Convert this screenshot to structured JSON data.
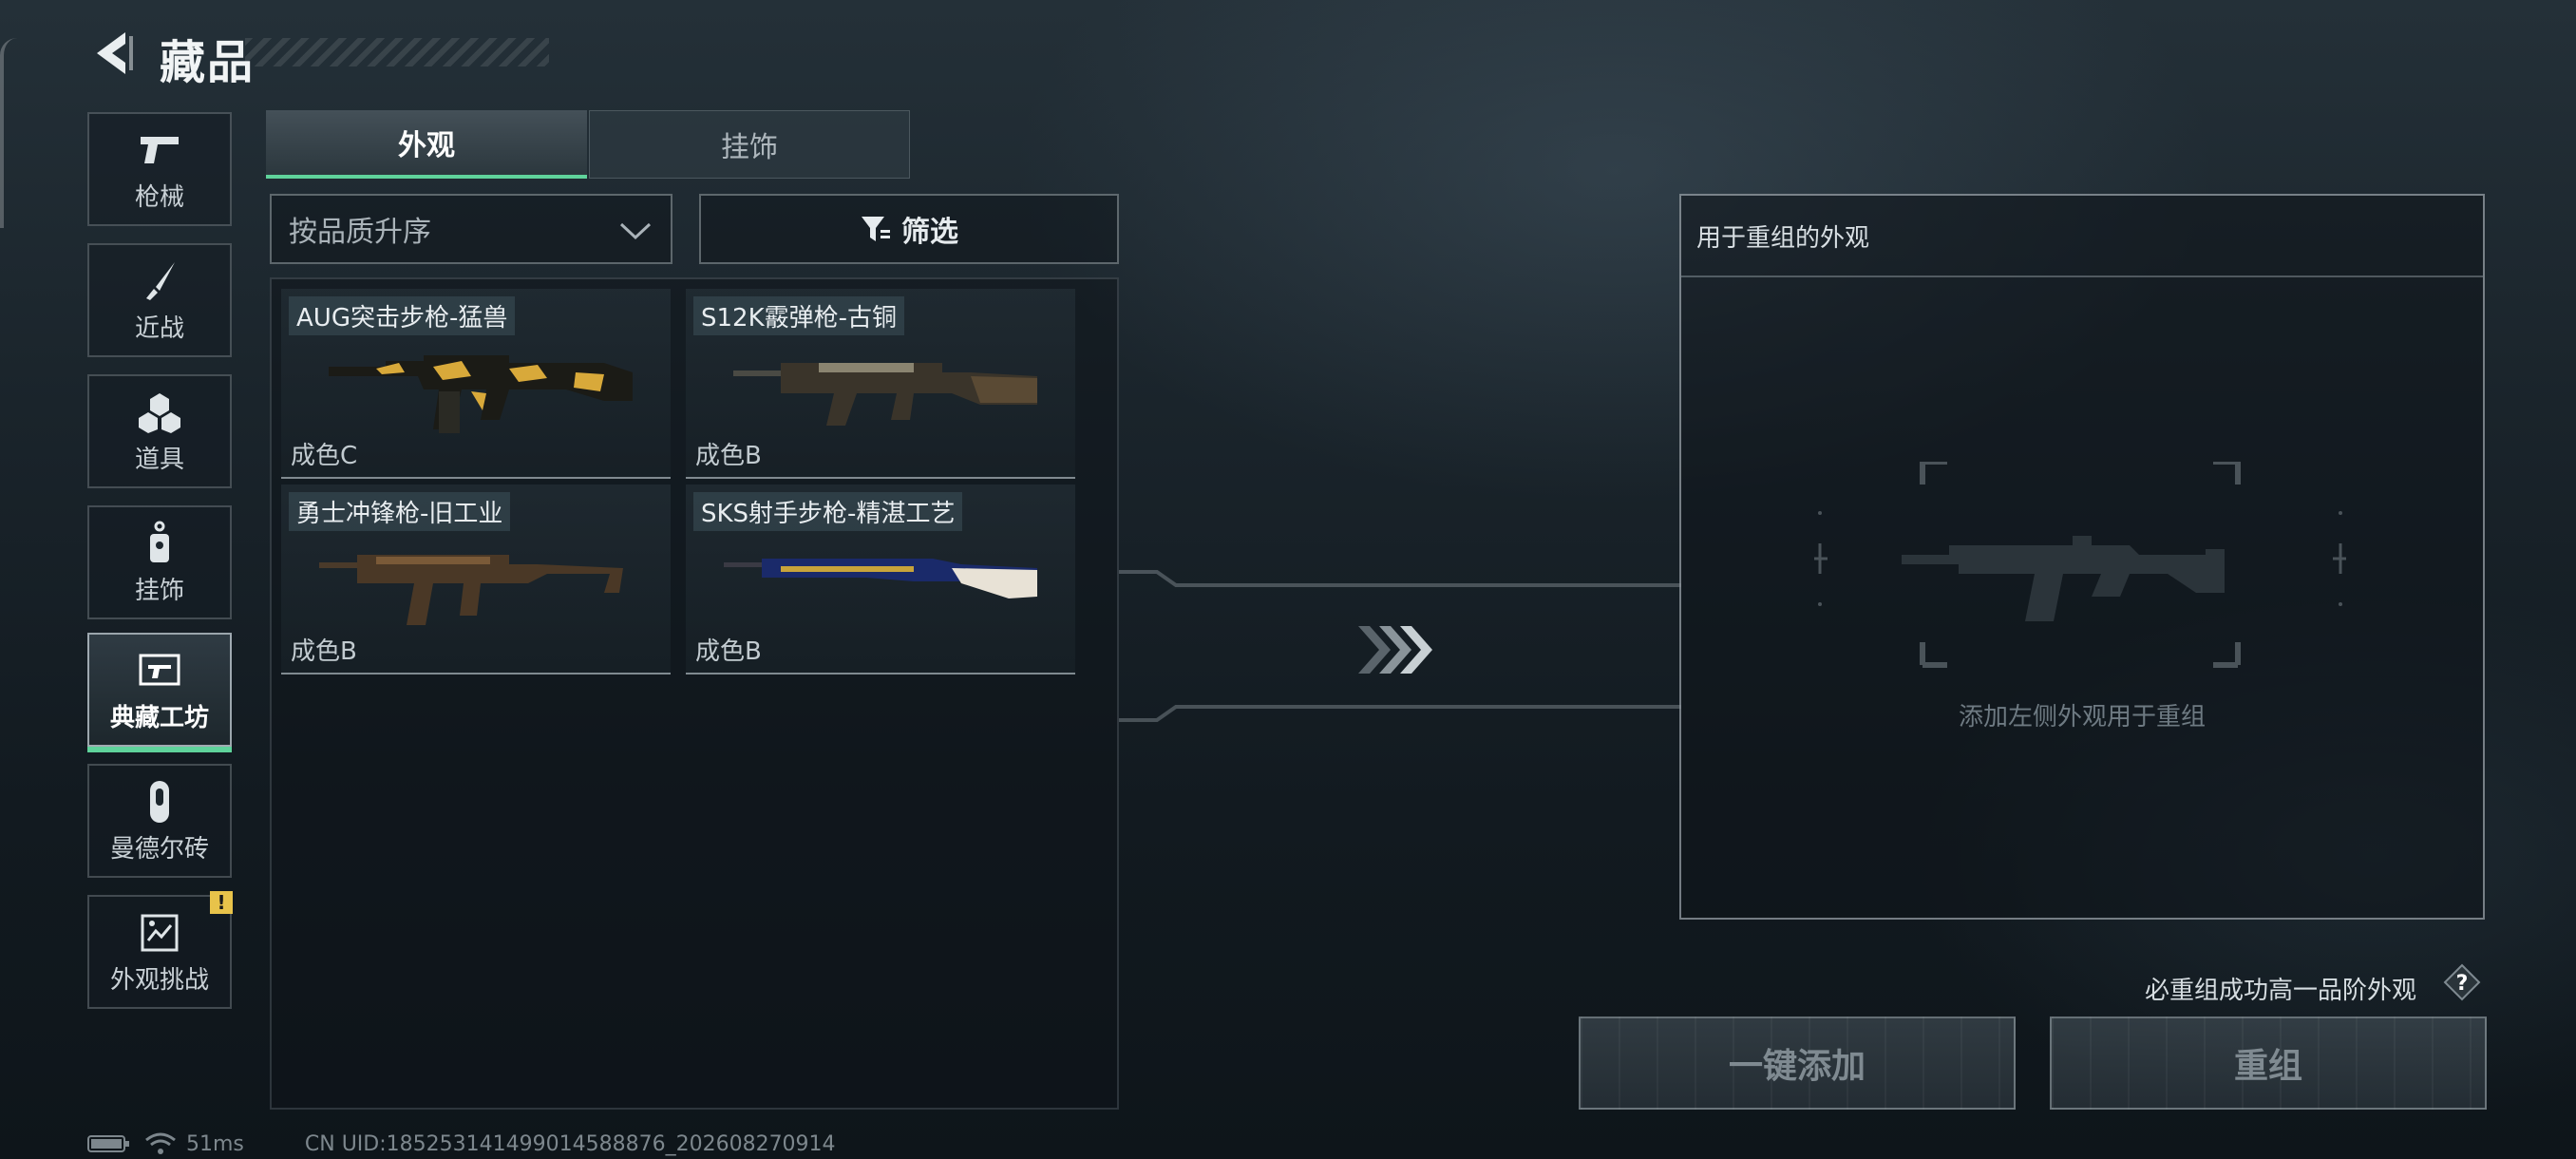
{
  "header": {
    "title": "藏品"
  },
  "sidebar": {
    "items": [
      {
        "label": "枪械",
        "icon": "pistol-icon"
      },
      {
        "label": "近战",
        "icon": "knife-icon"
      },
      {
        "label": "道具",
        "icon": "cubes-icon"
      },
      {
        "label": "挂饰",
        "icon": "charm-icon"
      },
      {
        "label": "典藏工坊",
        "icon": "workshop-icon",
        "active": true
      },
      {
        "label": "曼德尔砖",
        "icon": "mandel-brick-icon"
      },
      {
        "label": "外观挑战",
        "icon": "challenge-icon",
        "badge": "!"
      }
    ]
  },
  "tabs": [
    {
      "label": "外观",
      "active": true
    },
    {
      "label": "挂饰",
      "active": false
    }
  ],
  "sort": {
    "value": "按品质升序"
  },
  "filter": {
    "label": "筛选"
  },
  "items": [
    {
      "name": "AUG突击步枪-猛兽",
      "grade": "成色C"
    },
    {
      "name": "S12K霰弹枪-古铜",
      "grade": "成色B"
    },
    {
      "name": "勇士冲锋枪-旧工业",
      "grade": "成色B"
    },
    {
      "name": "SKS射手步枪-精湛工艺",
      "grade": "成色B"
    }
  ],
  "recombine": {
    "title": "用于重组的外观",
    "empty_hint": "添加左侧外观用于重组"
  },
  "note": "必重组成功高一品阶外观",
  "buttons": {
    "add_all": "一键添加",
    "recombine": "重组"
  },
  "status": {
    "ping": "51ms",
    "uid": "CN UID:1852531414990145888​76_202608270914"
  },
  "colors": {
    "accent": "#5fd39b",
    "badge": "#e8c34a"
  }
}
